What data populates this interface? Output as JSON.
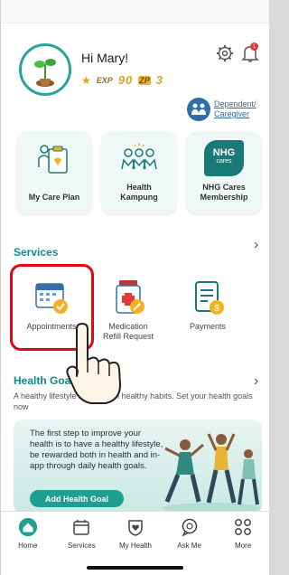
{
  "header": {
    "greeting": "Hi Mary!",
    "exp_label": "EXP",
    "exp_value": "90",
    "zp_label": "ZP",
    "zp_value": "3",
    "notification_count": "1",
    "dependent_line1": "Dependent/",
    "dependent_line2": "Caregiver"
  },
  "cards": [
    {
      "label": "My Care Plan"
    },
    {
      "label_line1": "Health",
      "label_line2": "Kampung"
    },
    {
      "label_line1": "NHG Cares",
      "label_line2": "Membership",
      "logo_text": "NHG",
      "logo_sub": "cares"
    }
  ],
  "services": {
    "title": "Services",
    "items": [
      {
        "label": "Appointments"
      },
      {
        "label_line1": "Medication",
        "label_line2": "Refill Request"
      },
      {
        "label": "Payments"
      }
    ]
  },
  "health_goals": {
    "title": "Health Goals",
    "description": "A healthy lifestyle begins with healthy habits. Set your health goals now",
    "banner_text": "The first step to improve your health is to have a healthy lifestyle, be rewarded both in health and in-app through daily health goals.",
    "button": "Add Health Goal"
  },
  "bottom_nav": [
    {
      "label": "Home",
      "icon": "home-icon"
    },
    {
      "label": "Services",
      "icon": "calendar-icon"
    },
    {
      "label": "My Health",
      "icon": "heart-shield-icon"
    },
    {
      "label": "Ask Me",
      "icon": "chat-icon"
    },
    {
      "label": "More",
      "icon": "grid-icon"
    }
  ],
  "colors": {
    "accent": "#1d9f92",
    "highlight": "#e30613",
    "link": "#2f6fa3"
  }
}
